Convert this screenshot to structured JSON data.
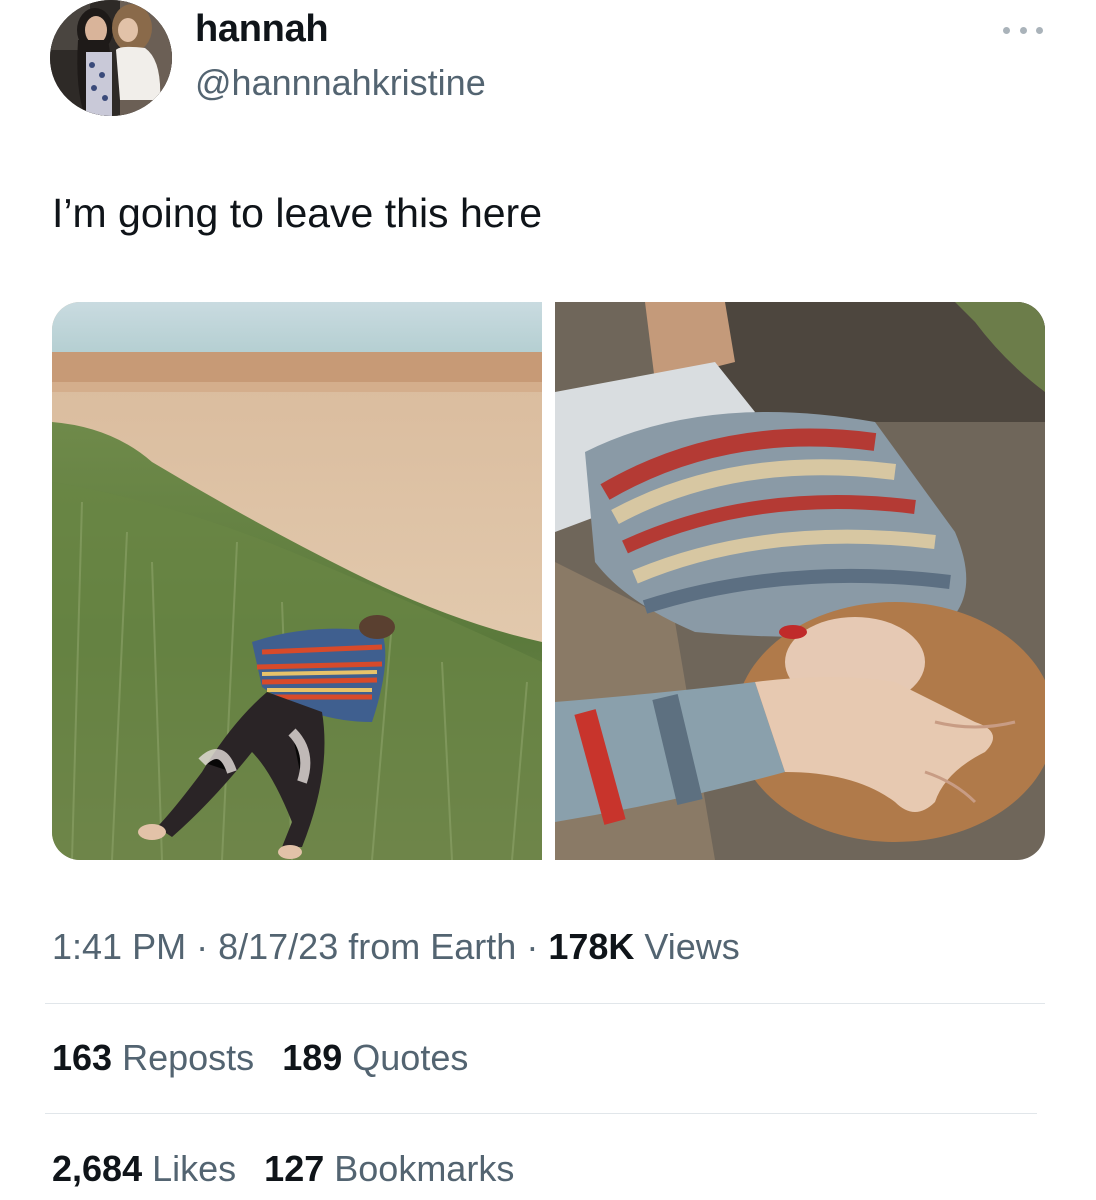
{
  "author": {
    "display_name": "hannah",
    "handle": "@hannnahkristine"
  },
  "more_icon": "more-dots-icon",
  "tweet": {
    "text": "I’m going to leave this here"
  },
  "media": [
    {
      "label": "photo-1-beach-grass"
    },
    {
      "label": "photo-2-striped-sweater-closeup"
    }
  ],
  "meta": {
    "time": "1:41 PM",
    "separator": "·",
    "date": "8/17/23",
    "source": "from Earth",
    "views_count": "178K",
    "views_label": "Views"
  },
  "stats": {
    "reposts_count": "163",
    "reposts_label": "Reposts",
    "quotes_count": "189",
    "quotes_label": "Quotes",
    "likes_count": "2,684",
    "likes_label": "Likes",
    "bookmarks_count": "127",
    "bookmarks_label": "Bookmarks"
  },
  "colors": {
    "text_primary": "#0f1419",
    "text_secondary": "#536471",
    "divider": "#e1e6ea"
  }
}
